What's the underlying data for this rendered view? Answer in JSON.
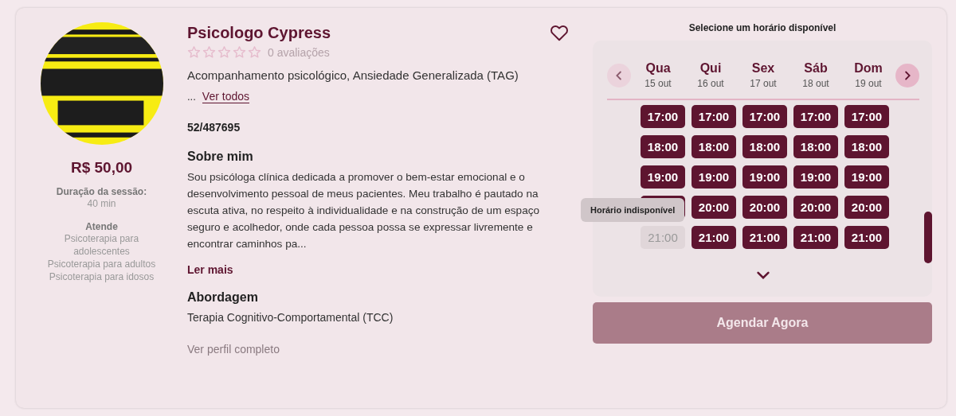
{
  "profile": {
    "price": "R$ 50,00",
    "duration_label": "Duração da sessão:",
    "duration": "40 min",
    "serves_label": "Atende",
    "serves": [
      "Psicoterapia para adolescentes",
      "Psicoterapia para adultos",
      "Psicoterapia para idosos"
    ]
  },
  "details": {
    "name": "Psicologo Cypress",
    "favorite": false,
    "stars": 0,
    "reviews": "0 avaliações",
    "specialties": "Acompanhamento psicológico, Ansiedade Generalizada (TAG)",
    "ellipsis": "...",
    "see_all": "Ver todos",
    "registration": "52/487695",
    "about_title": "Sobre mim",
    "about": "Sou psicóloga clínica dedicada a promover o bem-estar emocional e o desenvolvimento pessoal de meus pacientes. Meu trabalho é pautado na escuta ativa, no respeito à individualidade e na construção de um espaço seguro e acolhedor, onde cada pessoa possa se expressar livremente e encontrar caminhos pa...",
    "read_more": "Ler mais",
    "approach_title": "Abordagem",
    "approach": "Terapia Cognitivo-Comportamental (TCC)",
    "full_profile": "Ver perfil completo"
  },
  "schedule": {
    "title": "Selecione um horário disponível",
    "days": [
      {
        "day": "Qua",
        "date": "15 out",
        "slots": [
          {
            "time": "17:00",
            "available": true
          },
          {
            "time": "18:00",
            "available": true
          },
          {
            "time": "19:00",
            "available": true
          },
          {
            "available": true
          },
          {
            "time": "21:00",
            "available": false
          }
        ]
      },
      {
        "day": "Qui",
        "date": "16 out",
        "slots": [
          {
            "time": "17:00",
            "available": true
          },
          {
            "time": "18:00",
            "available": true
          },
          {
            "time": "19:00",
            "available": true
          },
          {
            "time": "20:00",
            "available": true
          },
          {
            "time": "21:00",
            "available": true
          }
        ]
      },
      {
        "day": "Sex",
        "date": "17 out",
        "slots": [
          {
            "time": "17:00",
            "available": true
          },
          {
            "time": "18:00",
            "available": true
          },
          {
            "time": "19:00",
            "available": true
          },
          {
            "time": "20:00",
            "available": true
          },
          {
            "time": "21:00",
            "available": true
          }
        ]
      },
      {
        "day": "Sáb",
        "date": "18 out",
        "slots": [
          {
            "time": "17:00",
            "available": true
          },
          {
            "time": "18:00",
            "available": true
          },
          {
            "time": "19:00",
            "available": true
          },
          {
            "time": "20:00",
            "available": true
          },
          {
            "time": "21:00",
            "available": true
          }
        ]
      },
      {
        "day": "Dom",
        "date": "19 out",
        "slots": [
          {
            "time": "17:00",
            "available": true
          },
          {
            "time": "18:00",
            "available": true
          },
          {
            "time": "19:00",
            "available": true
          },
          {
            "time": "20:00",
            "available": true
          },
          {
            "time": "21:00",
            "available": true
          }
        ]
      }
    ],
    "tooltip": "Horário indisponível",
    "book": {
      "label": "Agendar Agora",
      "disabled": true
    }
  }
}
